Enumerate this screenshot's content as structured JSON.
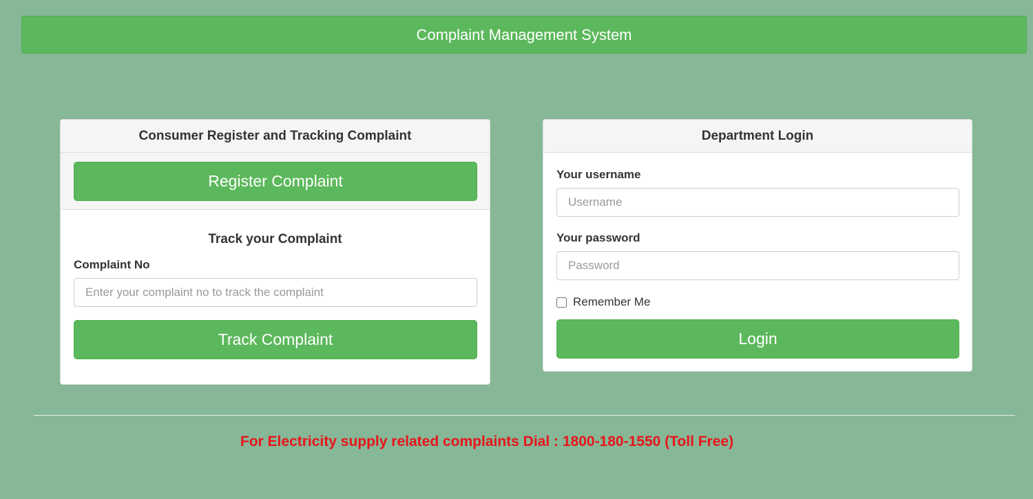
{
  "header": {
    "title": "Complaint Management System"
  },
  "consumer": {
    "title": "Consumer Register and Tracking Complaint",
    "register_label": "Register Complaint",
    "track_title": "Track your Complaint",
    "complaint_no_label": "Complaint No",
    "complaint_no_placeholder": "Enter your complaint no to track the complaint",
    "complaint_no_value": "",
    "track_label": "Track Complaint"
  },
  "department": {
    "title": "Department Login",
    "username_label": "Your username",
    "username_placeholder": "Username",
    "password_label": "Your password",
    "password_placeholder": "Password",
    "remember_label": "Remember Me",
    "remember_checked": false,
    "login_label": "Login"
  },
  "footer": {
    "notice": "For Electricity supply related complaints Dial : 1800-180-1550 (Toll Free)"
  },
  "colors": {
    "background": "#86b898",
    "accent": "#5cb85c",
    "notice": "#e8151b"
  }
}
